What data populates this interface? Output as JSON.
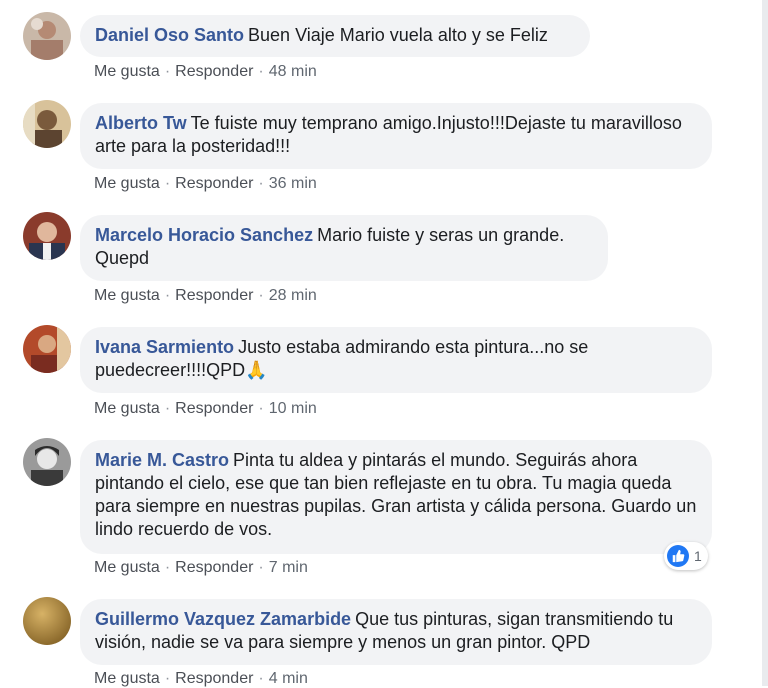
{
  "comments": [
    {
      "author": "Daniel Oso Santo",
      "text": "Buen Viaje Mario vuela alto y se Feliz",
      "actions": {
        "like": "Me gusta",
        "reply": "Responder",
        "time": "48 min"
      }
    },
    {
      "author": "Alberto Tw",
      "text": "Te fuiste muy temprano amigo.Injusto!!!Dejaste tu maravilloso arte para la posteridad!!!",
      "actions": {
        "like": "Me gusta",
        "reply": "Responder",
        "time": "36 min"
      }
    },
    {
      "author": "Marcelo Horacio Sanchez",
      "text": "Mario fuiste y seras un grande. Quepd",
      "actions": {
        "like": "Me gusta",
        "reply": "Responder",
        "time": "28 min"
      }
    },
    {
      "author": "Ivana Sarmiento",
      "text": "Justo estaba admirando esta pintura...no se puedecreer!!!!QPD🙏",
      "actions": {
        "like": "Me gusta",
        "reply": "Responder",
        "time": "10 min"
      }
    },
    {
      "author": "Marie M. Castro",
      "text": "Pinta tu aldea y pintarás el mundo. Seguirás ahora pintando el cielo, ese que tan bien reflejaste en tu obra. Tu magia queda para siempre en nuestras pupilas. Gran artista y cálida persona. Guardo un lindo recuerdo de vos.",
      "actions": {
        "like": "Me gusta",
        "reply": "Responder",
        "time": "7 min"
      },
      "reaction_count": "1"
    },
    {
      "author": "Guillermo Vazquez Zamarbide",
      "text": "Que tus pinturas, sigan transmitiendo tu visión, nadie se va para siempre y menos un gran pintor. QPD",
      "actions": {
        "like": "Me gusta",
        "reply": "Responder",
        "time": "4 min"
      }
    }
  ],
  "separator": "·",
  "colors": {
    "author": "#385898",
    "bubble": "#f2f3f5",
    "like_blue": "#2078f4",
    "meta": "#606770"
  }
}
